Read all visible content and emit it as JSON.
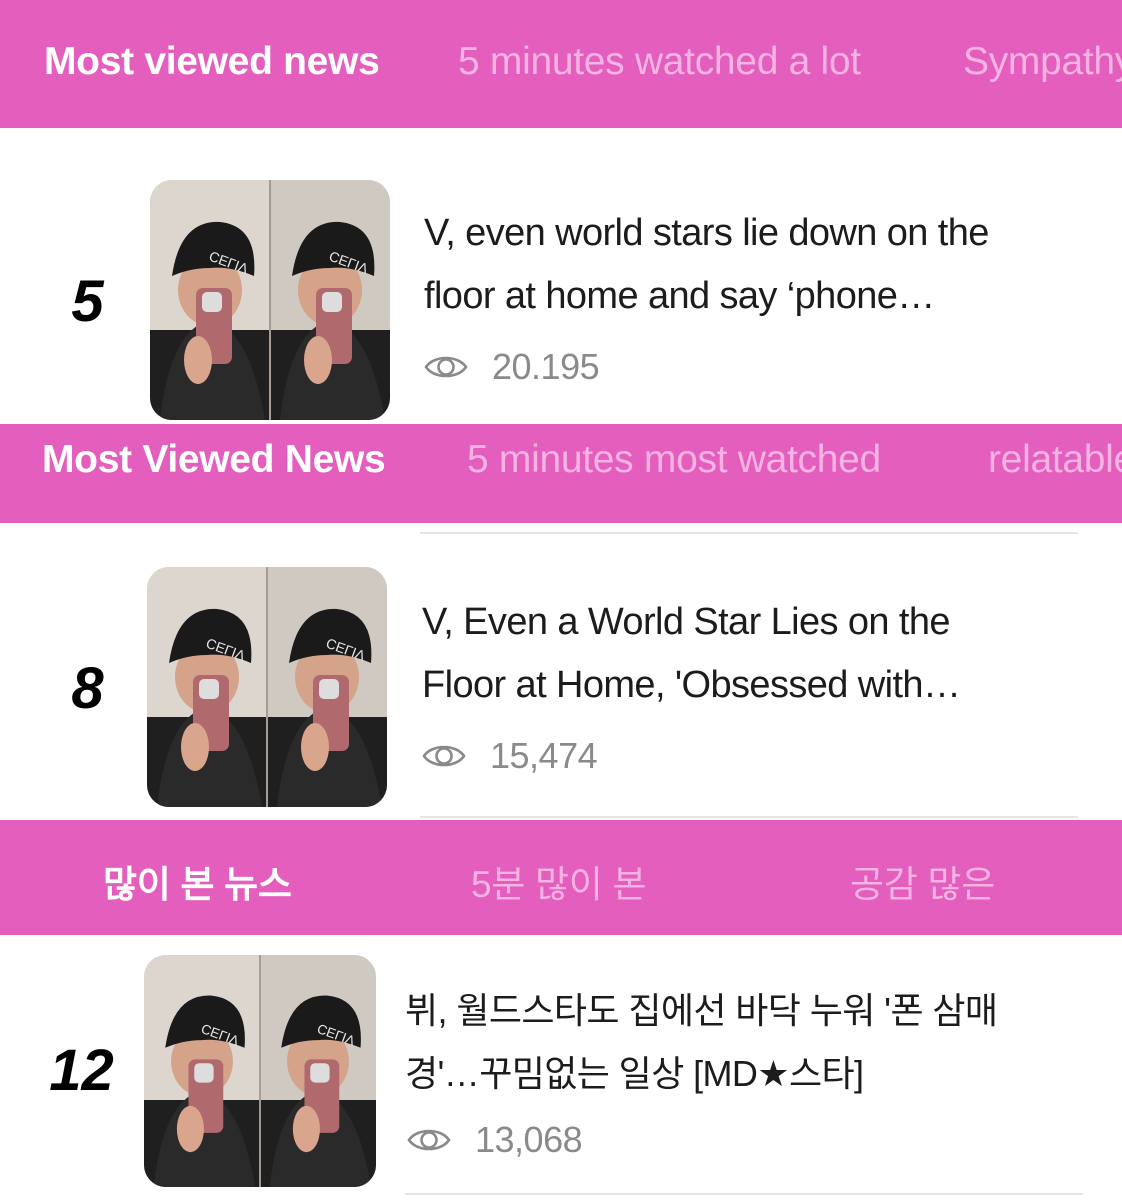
{
  "sections": [
    {
      "tabs": [
        "Most viewed news",
        "5 minutes watched a lot",
        "Sympathy"
      ],
      "item": {
        "rank": "5",
        "headline_line1": "V, even world stars lie down on the",
        "headline_line2": "floor at home and say ‘phone…",
        "views": "20.195",
        "view_icon": "eye-icon",
        "thumbnail": "photo of person in black beanie taking mirror selfie"
      }
    },
    {
      "tabs": [
        "Most Viewed News",
        "5 minutes most watched",
        "relatable"
      ],
      "item": {
        "rank": "8",
        "headline_line1": "V, Even a World Star Lies on the",
        "headline_line2": "Floor at Home, 'Obsessed with…",
        "views": "15,474",
        "view_icon": "eye-icon",
        "thumbnail": "photo of person in black beanie taking mirror selfie"
      }
    },
    {
      "tabs": [
        "많이 본 뉴스",
        "5분 많이 본",
        "공감 많은"
      ],
      "item": {
        "rank": "12",
        "headline_line1": "뷔, 월드스타도 집에선 바닥 누워 '폰 삼매",
        "headline_line2": "경'…꾸밈없는 일상 [MD★스타]",
        "views": "13,068",
        "view_icon": "eye-icon",
        "thumbnail": "photo of person in black beanie taking mirror selfie"
      }
    }
  ],
  "colors": {
    "tabbar_bg": "#e35ebd",
    "tab_active": "#ffffff",
    "tab_inactive": "#f5b3e3",
    "views_text": "#8a8a8a"
  }
}
